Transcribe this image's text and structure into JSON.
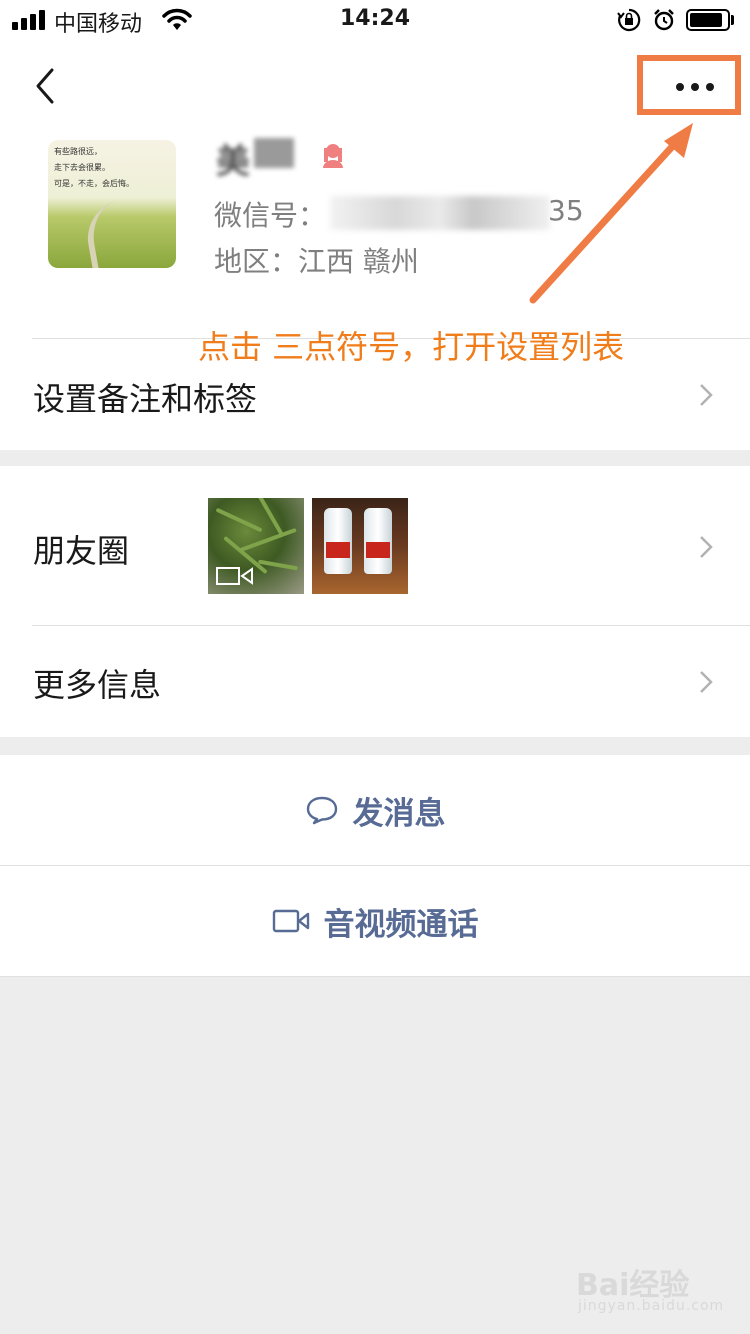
{
  "status_bar": {
    "carrier": "中国移动",
    "time": "14:24",
    "battery_level": 0.85
  },
  "header": {
    "back_icon": "chevron-left-icon",
    "more_icon": "ellipsis-icon"
  },
  "profile": {
    "avatar_text": [
      "有些路很远，",
      "走下去会很累。",
      "可是，不走，会后悔。"
    ],
    "nickname_visible": "美",
    "gender_icon": "female-icon",
    "wechat_id_label": "微信号：",
    "wechat_id_tail": "35",
    "region": "地区：江西 赣州"
  },
  "annotation": {
    "text": "点击 三点符号，打开设置列表",
    "color": "#f07c45"
  },
  "rows": {
    "remark_label": "设置备注和标签",
    "moments_label": "朋友圈",
    "more_info_label": "更多信息"
  },
  "actions": {
    "message_label": "发消息",
    "call_label": "音视频通话",
    "accent": "#576b95"
  },
  "watermark": {
    "main": "Bai经验",
    "sub": "jingyan.baidu.com"
  }
}
